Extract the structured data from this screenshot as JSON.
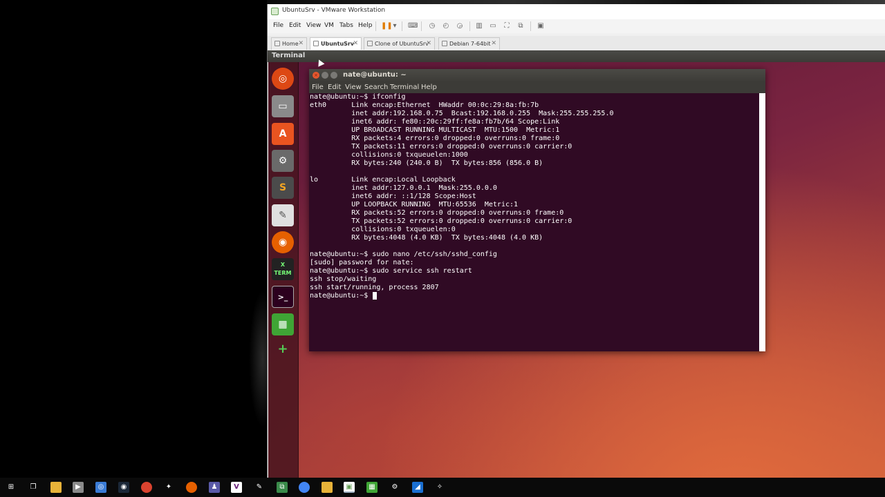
{
  "vmware": {
    "window_title": "UbuntuSrv - VMware Workstation",
    "menu": [
      "File",
      "Edit",
      "View",
      "VM",
      "Tabs",
      "Help"
    ],
    "tabs": [
      {
        "label": "Home",
        "active": false
      },
      {
        "label": "UbuntuSrv",
        "active": true
      },
      {
        "label": "Clone of UbuntuSrv",
        "active": false
      },
      {
        "label": "Debian 7-64bit",
        "active": false
      }
    ],
    "tab_close_glyph": "✕",
    "status_title": "Terminal"
  },
  "terminal": {
    "title": "nate@ubuntu: ~",
    "menu": [
      "File",
      "Edit",
      "View",
      "Search",
      "Terminal",
      "Help"
    ],
    "lines": [
      "nate@ubuntu:~$ ifconfig",
      "eth0      Link encap:Ethernet  HWaddr 00:0c:29:8a:fb:7b",
      "          inet addr:192.168.0.75  Bcast:192.168.0.255  Mask:255.255.255.0",
      "          inet6 addr: fe80::20c:29ff:fe8a:fb7b/64 Scope:Link",
      "          UP BROADCAST RUNNING MULTICAST  MTU:1500  Metric:1",
      "          RX packets:4 errors:0 dropped:0 overruns:0 frame:0",
      "          TX packets:11 errors:0 dropped:0 overruns:0 carrier:0",
      "          collisions:0 txqueuelen:1000",
      "          RX bytes:240 (240.0 B)  TX bytes:856 (856.0 B)",
      "",
      "lo        Link encap:Local Loopback",
      "          inet addr:127.0.0.1  Mask:255.0.0.0",
      "          inet6 addr: ::1/128 Scope:Host",
      "          UP LOOPBACK RUNNING  MTU:65536  Metric:1",
      "          RX packets:52 errors:0 dropped:0 overruns:0 frame:0",
      "          TX packets:52 errors:0 dropped:0 overruns:0 carrier:0",
      "          collisions:0 txqueuelen:0",
      "          RX bytes:4048 (4.0 KB)  TX bytes:4048 (4.0 KB)",
      "",
      "nate@ubuntu:~$ sudo nano /etc/ssh/sshd_config",
      "[sudo] password for nate:",
      "nate@ubuntu:~$ sudo service ssh restart",
      "ssh stop/waiting",
      "ssh start/running, process 2807",
      "nate@ubuntu:~$ "
    ]
  },
  "launcher": [
    {
      "icon": "ubuntu-dash-icon",
      "color": "#dd4814"
    },
    {
      "icon": "files-icon",
      "color": "#8a8a8a"
    },
    {
      "icon": "software-center-icon",
      "color": "#e95420"
    },
    {
      "icon": "system-settings-icon",
      "color": "#aaaaaa"
    },
    {
      "icon": "sublime-text-icon",
      "color": "#4b4b4b"
    },
    {
      "icon": "text-editor-icon",
      "color": "#e0e0e0"
    },
    {
      "icon": "firefox-icon",
      "color": "#e66000"
    },
    {
      "icon": "xterm-icon",
      "color": "#222222"
    },
    {
      "icon": "terminal-icon",
      "color": "#2c001e"
    },
    {
      "icon": "libreoffice-calc-icon",
      "color": "#3fa535"
    },
    {
      "icon": "add-icon",
      "color": "#2e9d2e"
    }
  ],
  "taskbar_icons": [
    "windows-start-icon",
    "task-view-icon",
    "file-explorer-icon",
    "media-player-icon",
    "app-icon",
    "steam-icon",
    "app-icon",
    "app-icon",
    "firefox-icon",
    "app-icon",
    "visual-studio-icon",
    "app-icon",
    "app-icon",
    "chrome-icon",
    "folder-icon",
    "vmware-icon",
    "spreadsheet-icon",
    "settings-icon",
    "app-icon",
    "app-icon"
  ],
  "colors": {
    "terminal_bg": "#300a24",
    "ubuntu_orange": "#e95420",
    "pause_orange": "#e07b00"
  }
}
